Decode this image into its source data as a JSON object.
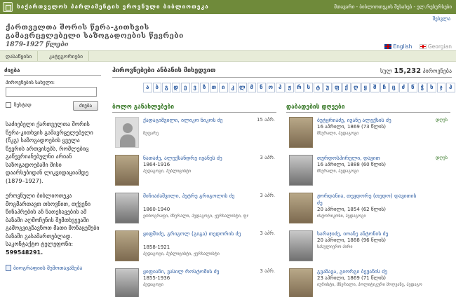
{
  "topbar": {
    "title": "საქართველოს პარლამენტის ეროვნული ბიბლიოთეკა",
    "right": "მთავარი - ბიბლიოთეკის შესახებ - ელ.რესურსები"
  },
  "login": "შესვლა",
  "site": {
    "line1": "ქართველთა შორის წერა-კითხვის",
    "line2": "გამავრცელებელი საზოგადოების წევრები",
    "line3": "1879-1927 წლები"
  },
  "languages": {
    "en": "English",
    "ka": "Georgian"
  },
  "nav": {
    "home": "დასაწყისი",
    "categories": "კატეგორიები"
  },
  "sidebar": {
    "search_header": "ძიება",
    "name_label": "პიროვნების სახელი:",
    "exact_label": "ზუსტად",
    "search_button": "ძიება",
    "about": "საძიებელი ქართველთა შორის წერა-კითხვის გამავრცელებელი (წკგ) საზოგადოების ყველა წევრის ართვისებს, რომლებიც გაწევრიანებულნი არიან საზოგადოებაში მისი დაარსებიდან ლიკვიდაციამდე (1879–1927).",
    "about2_pre": "ეროვნული ბიბლიოთეკა მოგმართავთ თხოვნით, თქვენი წინაპრების ან ნათესავების ამ ბაზაში აღმოჩენის შემთხვევაში გამოგვიგზავნოთ მათი მონაცემები ბაზაში გასამართებლად. საკონტაქტო ტელეფონი:",
    "phone": "599548291.",
    "form_link": "ბიოგრაფიის შემოთავაზება"
  },
  "main": {
    "title": "პიროვნებები ანბანის მიხედვით",
    "total_pre": "სულ",
    "total_count": "15,232",
    "total_post": "პიროვნება",
    "alphabet": [
      "ა",
      "ბ",
      "გ",
      "დ",
      "ე",
      "ვ",
      "ზ",
      "თ",
      "ი",
      "კ",
      "ლ",
      "მ",
      "ნ",
      "ო",
      "პ",
      "ჟ",
      "რ",
      "ს",
      "ტ",
      "უ",
      "ფ",
      "ქ",
      "ღ",
      "ყ",
      "შ",
      "ჩ",
      "ც",
      "ძ",
      "წ",
      "ჭ",
      "ხ",
      "ჯ",
      "ჰ"
    ],
    "latest_header": "ბოლო განახლებები",
    "birthdays_header": "დაბადების დღეები",
    "latest": [
      {
        "name": "ქადაგიშვილი, ილიკო ნიკოს ძე",
        "ago": "15 აპრ.",
        "dates": "",
        "prof": "მეფარე"
      },
      {
        "name": "ნათაძე, ალექსანდრე ივანეს ძე",
        "ago": "3 აპრ.",
        "dates": "1864-1916",
        "prof": "პედაგოგი, პუბლიცისტი"
      },
      {
        "name": "მიჩიაძაშვილი, პეტრე გრიგოლის ძე",
        "ago": "3 აპრ.",
        "dates": "1860-1940",
        "prof": "ეთნოგრაფი, მწერალი, პედაგოგი, ჟურნალისტი, ფოლკლორისტი"
      },
      {
        "name": "ყიფშიძე, გრიგოლ (გიგა) თედორის ძე",
        "ago": "3 აპრ.",
        "dates": "1858-1921",
        "prof": "პედაგოგი, პუბლიცისტი, ჟურნალისტი"
      },
      {
        "name": "ყიფიანი, ვასილ როსტომის ძე",
        "ago": "3 აპრ.",
        "dates": "1855-1936",
        "prof": "პედაგოგი"
      }
    ],
    "birthdays": [
      {
        "name": "ბუტყრიაძე, ივანე ალექსის ძე",
        "cake": "დღეს",
        "dates": "16 აპრილი, 1869 (73 წლის)",
        "prof": "მწერალი, პედაგოგი"
      },
      {
        "name": "თურდოსპირელი, დავით",
        "cake": "დღეს",
        "dates": "16 აპრილი, 1888 (60 წლის)",
        "prof": "მწერალი, პედაგოგი"
      },
      {
        "name": "ჟორდანია, თევდორე (თედო) დავითის ძე",
        "cake": "",
        "dates": "20 აპრილი, 1854 (62 წლის)",
        "prof": "ისტორიკოსი, პედაგოგი"
      },
      {
        "name": "სარაჯიძე, იოანე ანტონის ძე",
        "cake": "",
        "dates": "20 აპრილი, 1888 (96 წლის)",
        "prof": "სასულიერო პირი"
      },
      {
        "name": "გვაზავა, გიორგი ბეჟანის ძე",
        "cake": "",
        "dates": "23 აპრილი, 1869 (71 წლის)",
        "prof": "იურისტი, მწერალი, პოლიტიკური მოღვაწე, პედაგოგი"
      }
    ]
  }
}
